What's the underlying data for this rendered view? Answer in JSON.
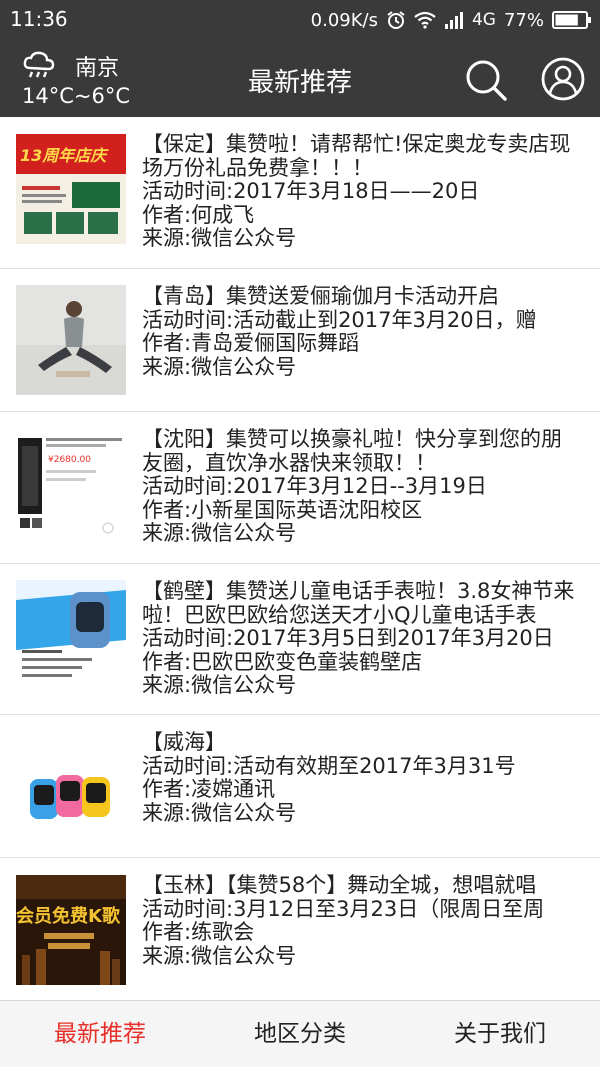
{
  "status_bar": {
    "time": "11:36",
    "net_speed": "0.09K/s",
    "network_type": "4G",
    "battery": "77%",
    "battery_level": 0.77
  },
  "app_bar": {
    "title": "最新推荐",
    "city": "南京",
    "temperature": "14°C~6°C",
    "weather_icon": "rain-cloud-icon",
    "search_icon": "search-icon",
    "user_icon": "user-profile-icon"
  },
  "items": [
    {
      "title": "【保定】集赞啦！请帮帮忙!保定奥龙专卖店现场万份礼品免费拿！！！",
      "time": "活动时间:2017年3月18日——20日",
      "author": "作者:何成飞",
      "source": "来源:微信公众号",
      "thumb": {
        "banner_text": "13周年店庆",
        "accent": "#d2201f"
      }
    },
    {
      "title": "【青岛】集赞送爱俪瑜伽月卡活动开启",
      "time": "活动时间:活动截止到2017年3月20日，赠",
      "author": "作者:青岛爱俪国际舞蹈",
      "source": "来源:微信公众号",
      "thumb": {}
    },
    {
      "title": "【沈阳】集赞可以换豪礼啦！快分享到您的朋友圈，直饮净水器快来领取！！",
      "time": "活动时间:2017年3月12日--3月19日",
      "author": "作者:小新星国际英语沈阳校区",
      "source": "来源:微信公众号",
      "thumb": {
        "price_text": "¥2680.00"
      }
    },
    {
      "title": "【鹤壁】集赞送儿童电话手表啦！3.8女神节来啦！巴欧巴欧给您送天才小Q儿童电话手表",
      "time": "活动时间:2017年3月5日到2017年3月20日",
      "author": "作者:巴欧巴欧变色童装鹤壁店",
      "source": "来源:微信公众号",
      "thumb": {}
    },
    {
      "title": "【威海】",
      "time": "活动时间:活动有效期至2017年3月31号",
      "author": "作者:凌嫦通讯",
      "source": "来源:微信公众号",
      "thumb": {}
    },
    {
      "title": "【玉林】【集赞58个】舞动全城，想唱就唱",
      "time": "活动时间:3月12日至3月23日（限周日至周",
      "author": "作者:练歌会",
      "source": "来源:微信公众号",
      "thumb": {
        "banner_text": "会员免费K歌"
      }
    }
  ],
  "bottom_nav": [
    {
      "label": "最新推荐",
      "active": true
    },
    {
      "label": "地区分类",
      "active": false
    },
    {
      "label": "关于我们",
      "active": false
    }
  ],
  "colors": {
    "bar_bg": "#3a3a3a",
    "active_tab": "#e8302a",
    "divider": "#e2e2e2"
  }
}
